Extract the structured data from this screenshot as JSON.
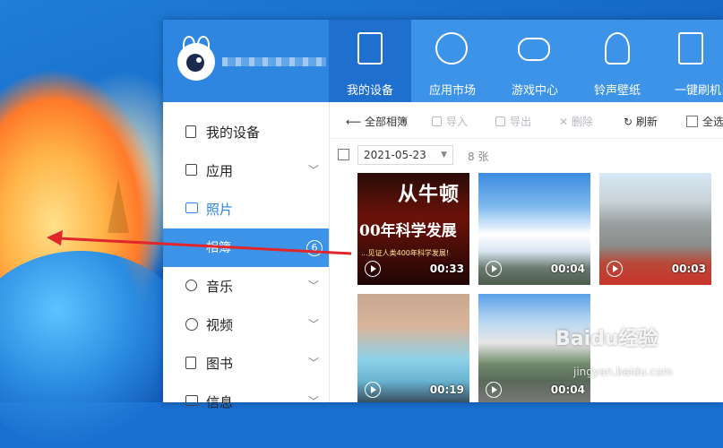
{
  "app": {
    "name_blurred": ""
  },
  "nav_tabs": [
    {
      "label": "我的设备",
      "icon": "tablet-icon",
      "active": true
    },
    {
      "label": "应用市场",
      "icon": "apps-grid-icon",
      "active": false
    },
    {
      "label": "游戏中心",
      "icon": "gamepad-icon",
      "active": false
    },
    {
      "label": "铃声壁纸",
      "icon": "bell-icon",
      "active": false
    },
    {
      "label": "一键刷机",
      "icon": "flash-phone-icon",
      "active": false
    }
  ],
  "sidebar": {
    "items": [
      {
        "label": "我的设备",
        "icon": "phone-icon"
      },
      {
        "label": "应用",
        "icon": "grid-icon",
        "chevron": "﹀"
      },
      {
        "label": "照片",
        "icon": "image-icon"
      },
      {
        "label": "相簿",
        "badge": "6"
      },
      {
        "label": "音乐",
        "icon": "music-icon",
        "chevron": "﹀"
      },
      {
        "label": "视频",
        "icon": "play-icon",
        "chevron": "﹀"
      },
      {
        "label": "图书",
        "icon": "book-icon",
        "chevron": "﹀"
      },
      {
        "label": "信息",
        "icon": "message-icon",
        "chevron": "﹀"
      }
    ]
  },
  "toolbar": {
    "back": "全部相簿",
    "import": "导入",
    "export": "导出",
    "delete": "删除",
    "refresh": "刷新",
    "select_all": "全选"
  },
  "filter": {
    "date": "2021-05-23",
    "count": "8 张"
  },
  "thumbs": [
    {
      "duration": "00:33",
      "text_big": "从牛顿",
      "text_mid": "00年科学发展",
      "text_small": "...见证人类400年科学发展!"
    },
    {
      "duration": "00:04"
    },
    {
      "duration": "00:03"
    },
    {
      "duration": "00:19"
    },
    {
      "duration": "00:04"
    }
  ],
  "watermark": {
    "main": "Baidu经验",
    "sub": "jingyan.baidu.com"
  },
  "colors": {
    "topbar": "#3d93e8",
    "active_tab": "#1f6fce",
    "selected_item": "#3d93e8",
    "arrow": "#e0262a"
  }
}
